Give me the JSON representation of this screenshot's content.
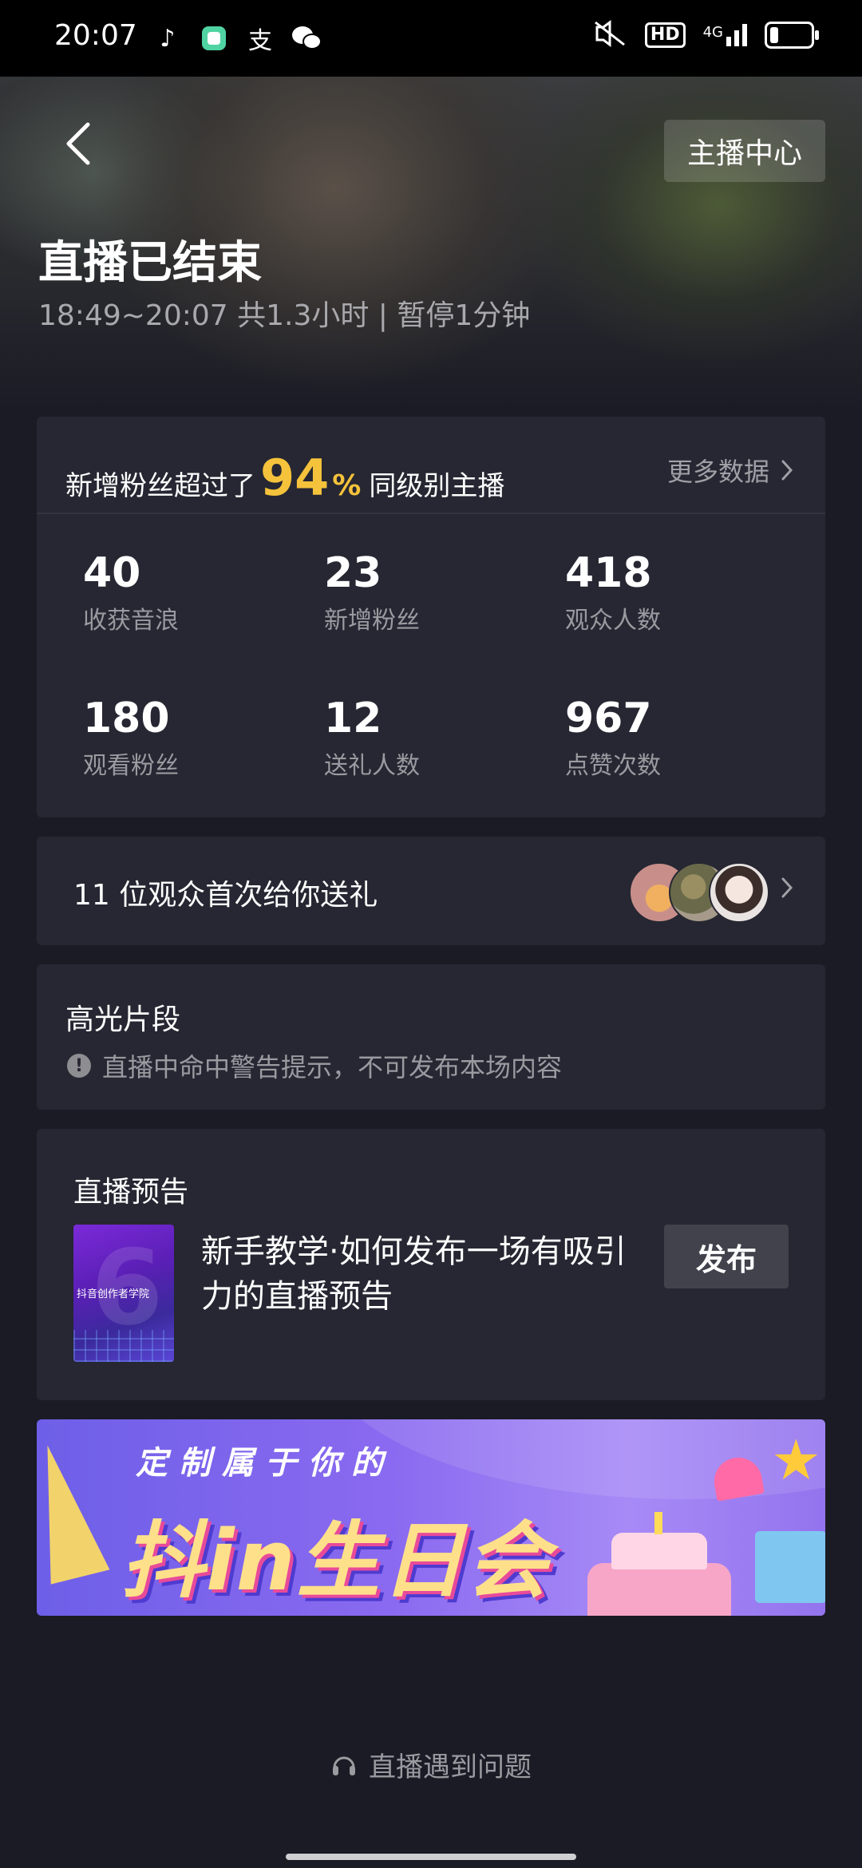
{
  "status_bar": {
    "time": "20:07",
    "app_icons": [
      "tiktok-icon",
      "app-icon",
      "alipay-icon",
      "wechat-icon"
    ],
    "hd_badge": "HD",
    "network": "4G"
  },
  "header": {
    "host_center_label": "主播中心",
    "title": "直播已结束",
    "subtitle": "18:49~20:07 共1.3小时 | 暂停1分钟"
  },
  "stats_card": {
    "fan_prefix": "新增粉丝超过了",
    "fan_percent": "94",
    "fan_percent_sign": "%",
    "fan_suffix": "同级别主播",
    "more_data_label": "更多数据",
    "stats": [
      {
        "value": "40",
        "label": "收获音浪"
      },
      {
        "value": "23",
        "label": "新增粉丝"
      },
      {
        "value": "418",
        "label": "观众人数"
      },
      {
        "value": "180",
        "label": "观看粉丝"
      },
      {
        "value": "12",
        "label": "送礼人数"
      },
      {
        "value": "967",
        "label": "点赞次数"
      }
    ]
  },
  "gift_card": {
    "text": "11 位观众首次给你送礼"
  },
  "highlight_card": {
    "title": "高光片段",
    "warning": "直播中命中警告提示，不可发布本场内容"
  },
  "preview_card": {
    "title": "直播预告",
    "thumb_tag": "抖音创作者学院",
    "description": "新手教学·如何发布一场有吸引力的直播预告",
    "publish_label": "发布"
  },
  "banner": {
    "line1": "定制属于你的",
    "line2": "抖in生日会"
  },
  "footer": {
    "problem_label": "直播遇到问题"
  },
  "colors": {
    "accent_yellow": "#f5c23b",
    "card_bg": "#262732",
    "page_bg": "#1a1b24"
  }
}
